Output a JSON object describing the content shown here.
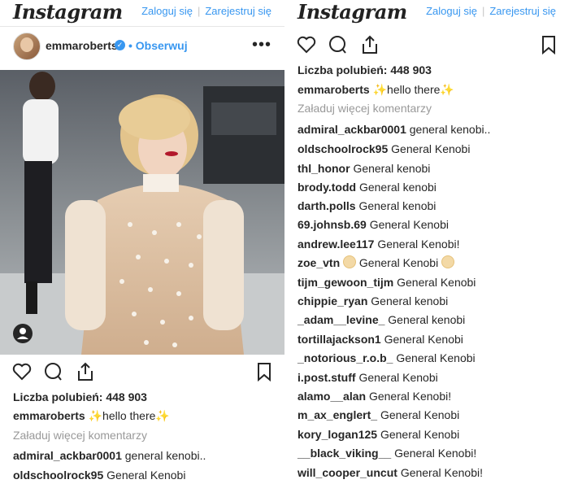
{
  "header": {
    "logo_text": "Instagram",
    "login_label": "Zaloguj się",
    "separator": "|",
    "register_label": "Zarejestruj się"
  },
  "post": {
    "username": "emmaroberts",
    "verified_badge": "✓",
    "follow_label": "• Obserwuj",
    "more_label": "•••",
    "likes_text": "Liczba polubień: 448 903",
    "caption_user": "emmaroberts",
    "caption_text": "hello there",
    "caption_emoji": "✨",
    "load_more_label": "Załaduj więcej komentarzy"
  },
  "icons": [
    "heart-icon",
    "comment-icon",
    "share-icon",
    "bookmark-icon",
    "person-tag-icon"
  ],
  "colors": {
    "link": "#3897f0",
    "text": "#262626",
    "muted": "#999999"
  },
  "comments": [
    {
      "user": "admiral_ackbar0001",
      "text": "general kenobi.."
    },
    {
      "user": "oldschoolrock95",
      "text": "General Kenobi"
    },
    {
      "user": "thl_honor",
      "text": "General kenobi"
    },
    {
      "user": "brody.todd",
      "text": "General kenobi"
    },
    {
      "user": "darth.polls",
      "text": "General kenobi"
    },
    {
      "user": "69.johnsb.69",
      "text": "General Kenobi"
    },
    {
      "user": "andrew.lee117",
      "text": "General Kenobi!"
    },
    {
      "user": "zoe_vtn",
      "text": "General Kenobi",
      "emoji": true
    },
    {
      "user": "tijm_gewoon_tijm",
      "text": "General Kenobi"
    },
    {
      "user": "chippie_ryan",
      "text": "General kenobi"
    },
    {
      "user": "_adam__levine_",
      "text": "General kenobi"
    },
    {
      "user": "tortillajackson1",
      "text": "General Kenobi"
    },
    {
      "user": "_notorious_r.o.b_",
      "text": "General Kenobi"
    },
    {
      "user": "i.post.stuff",
      "text": "General Kenobi"
    },
    {
      "user": "alamo__alan",
      "text": "General Kenobi!"
    },
    {
      "user": "m_ax_englert_",
      "text": "General Kenobi"
    },
    {
      "user": "kory_logan125",
      "text": "General Kenobi"
    },
    {
      "user": "__black_viking__",
      "text": "General Kenobi!"
    },
    {
      "user": "will_cooper_uncut",
      "text": "General Kenobi!"
    }
  ]
}
